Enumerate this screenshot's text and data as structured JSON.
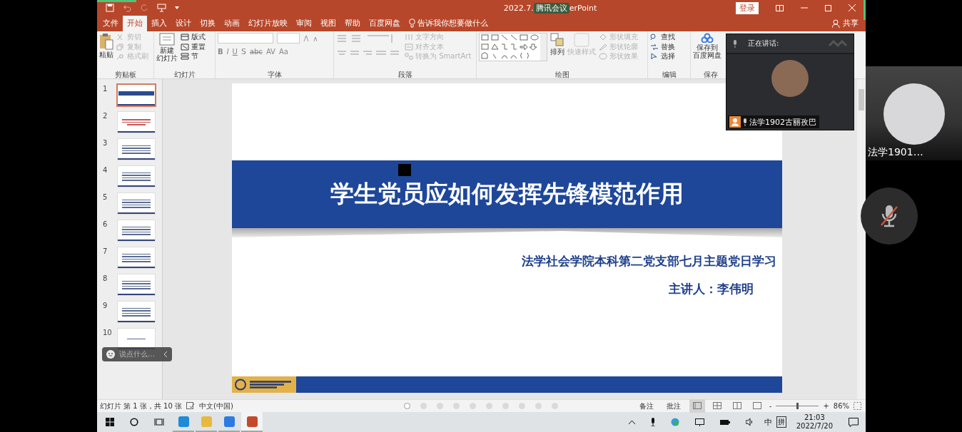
{
  "title_bar": {
    "title": "2022.7.",
    "meeting_badge": "腾讯会议",
    "title_tail": "erPoint",
    "login": "登录"
  },
  "ribbon_tabs": [
    {
      "label": "文件",
      "selected": false
    },
    {
      "label": "开始",
      "selected": true
    },
    {
      "label": "插入",
      "selected": false
    },
    {
      "label": "设计",
      "selected": false
    },
    {
      "label": "切换",
      "selected": false
    },
    {
      "label": "动画",
      "selected": false
    },
    {
      "label": "幻灯片放映",
      "selected": false
    },
    {
      "label": "审阅",
      "selected": false
    },
    {
      "label": "视图",
      "selected": false
    },
    {
      "label": "帮助",
      "selected": false
    },
    {
      "label": "百度网盘",
      "selected": false
    }
  ],
  "tell_me": "告诉我你想要做什么",
  "share": "共享",
  "clipboard": {
    "label": "剪贴板",
    "paste": "粘贴",
    "items": [
      {
        "label": "剪切",
        "kind": "cut",
        "disabled": true
      },
      {
        "label": "复制",
        "kind": "copy",
        "disabled": true
      },
      {
        "label": "格式刷",
        "kind": "brush",
        "disabled": true
      }
    ]
  },
  "slides_group": {
    "label": "幻灯片",
    "new_slide": "新建",
    "new_slide_2": "幻灯片",
    "items": [
      {
        "label": "版式",
        "kind": "layout",
        "disabled": false
      },
      {
        "label": "重置",
        "kind": "reset",
        "disabled": false
      },
      {
        "label": "节",
        "kind": "section",
        "disabled": false
      }
    ]
  },
  "font_group": {
    "label": "字体",
    "format_buttons": [
      "B",
      "I",
      "U",
      "S",
      "abc",
      "AV",
      "Aa"
    ]
  },
  "paragraph_group": {
    "label": "段落",
    "items": [
      {
        "label": "文字方向",
        "kind": "direction",
        "disabled": true
      },
      {
        "label": "对齐文本",
        "kind": "align",
        "disabled": true
      },
      {
        "label": "转换为 SmartArt",
        "kind": "smartart",
        "disabled": true
      }
    ]
  },
  "drawing_group": {
    "label": "绘图",
    "arrange": "排列",
    "quick_styles": "快速样式",
    "items": [
      {
        "label": "形状填充",
        "kind": "fill",
        "disabled": true
      },
      {
        "label": "形状轮廓",
        "kind": "outline",
        "disabled": true
      },
      {
        "label": "形状效果",
        "kind": "effect",
        "disabled": true
      }
    ]
  },
  "editing_group": {
    "label": "编辑",
    "items": [
      {
        "label": "查找",
        "kind": "find",
        "disabled": false
      },
      {
        "label": "替换",
        "kind": "replace",
        "disabled": false
      },
      {
        "label": "选择",
        "kind": "select",
        "disabled": false
      }
    ]
  },
  "save_group": {
    "label": "保存",
    "button_1": "保存到",
    "button_2": "百度网盘"
  },
  "thumbnails": [
    {
      "number": "1",
      "kind": "title",
      "selected": true
    },
    {
      "number": "2",
      "kind": "centered",
      "selected": false
    },
    {
      "number": "3",
      "kind": "text",
      "selected": false
    },
    {
      "number": "4",
      "kind": "text",
      "selected": false
    },
    {
      "number": "5",
      "kind": "text",
      "selected": false
    },
    {
      "number": "6",
      "kind": "text",
      "selected": false
    },
    {
      "number": "7",
      "kind": "text",
      "selected": false
    },
    {
      "number": "8",
      "kind": "text",
      "selected": false
    },
    {
      "number": "9",
      "kind": "text",
      "selected": false
    },
    {
      "number": "10",
      "kind": "end",
      "selected": false
    }
  ],
  "chat_bubble": {
    "placeholder": "说点什么…"
  },
  "slide": {
    "title": "学生党员应如何发挥先锋模范作用",
    "subtitle": "法学社会学院本科第二党支部七月主题党日学习",
    "presenter": "主讲人：李伟明"
  },
  "speaker_panel": {
    "heading": "正在讲话:",
    "name": "法学1902古丽孜巴"
  },
  "participant": {
    "name": "法学1901…",
    "muted": true
  },
  "status_bar": {
    "slide_info": "幻灯片 第 1 张，共 10 张",
    "language": "中文(中国)",
    "notes": "备注",
    "comments": "批注",
    "views": [
      {
        "kind": "normal",
        "selected": true
      },
      {
        "kind": "sorter",
        "selected": false
      },
      {
        "kind": "reading",
        "selected": false
      },
      {
        "kind": "show",
        "selected": false
      }
    ],
    "zoom_minus": "-",
    "zoom_plus": "+",
    "zoom": {
      "level": 0.5
    },
    "zoom_text": "86%"
  },
  "page_dots": [
    {
      "selected": true
    },
    {
      "selected": false
    },
    {
      "selected": false
    },
    {
      "selected": false
    },
    {
      "selected": false
    },
    {
      "selected": false
    },
    {
      "selected": false
    },
    {
      "selected": false
    },
    {
      "selected": false
    },
    {
      "selected": false
    }
  ],
  "taskbar": {
    "apps": [
      {
        "kind": "edge",
        "active": false
      },
      {
        "kind": "folder",
        "active": false
      },
      {
        "kind": "meeting",
        "active": false
      },
      {
        "kind": "powerpoint",
        "active": true
      }
    ],
    "ime_1": "中",
    "ime_2": "拼",
    "time": "21:03",
    "date": "2022/7/20"
  }
}
